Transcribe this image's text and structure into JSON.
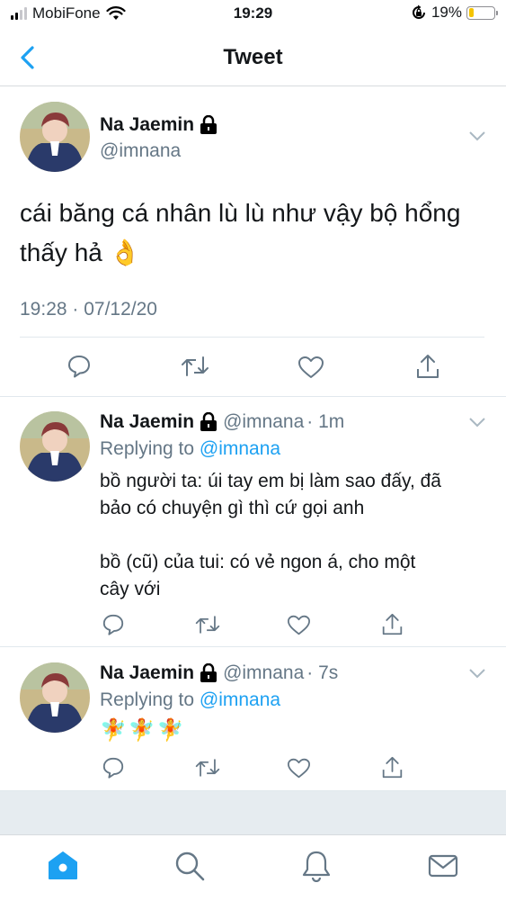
{
  "status_bar": {
    "carrier": "MobiFone",
    "time": "19:29",
    "battery_percent": "19%",
    "battery_level": 0.19
  },
  "nav": {
    "title": "Tweet",
    "back_icon": "chevron-left-icon"
  },
  "main_tweet": {
    "name": "Na Jaemin",
    "handle": "@imnana",
    "text_line1": "cái băng cá nhân lù lù như vậy bộ hổng",
    "text_line2": "thấy hả 👌",
    "timestamp": "19:28 · 07/12/20"
  },
  "replies": [
    {
      "name": "Na Jaemin",
      "handle": "@imnana",
      "time_ago": "· 1m",
      "replying_prefix": "Replying to ",
      "replying_to": "@imnana",
      "line1": "bồ người ta: úi tay em bị làm sao đấy, đã",
      "line2": "bảo có chuyện gì thì cứ gọi anh",
      "line3": "bồ (cũ) của tui: có vẻ ngon á, cho một",
      "line4": "cây với"
    },
    {
      "name": "Na Jaemin",
      "handle": "@imnana",
      "time_ago": "· 7s",
      "replying_prefix": "Replying to ",
      "replying_to": "@imnana",
      "line1": "🧚🧚🧚"
    }
  ],
  "colors": {
    "accent": "#1da1f2",
    "secondary_text": "#657786",
    "divider": "#e1e8ed",
    "battery": "#f5c400"
  },
  "tabs": [
    "home-icon",
    "search-icon",
    "notifications-icon",
    "messages-icon"
  ]
}
